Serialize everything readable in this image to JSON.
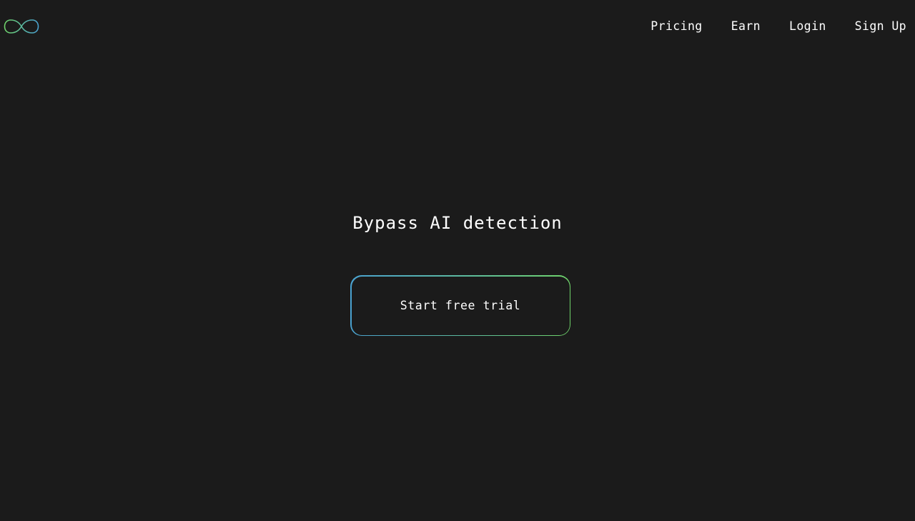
{
  "header": {
    "logo_icon": "infinity-icon",
    "nav": {
      "pricing": "Pricing",
      "earn": "Earn",
      "login": "Login",
      "signup": "Sign Up"
    }
  },
  "hero": {
    "title": "Bypass AI detection",
    "cta_label": "Start free trial"
  },
  "colors": {
    "background": "#1b1b1b",
    "text": "#ffffff",
    "accent_blue": "#4aa2d0",
    "accent_green": "#6fd36a"
  }
}
